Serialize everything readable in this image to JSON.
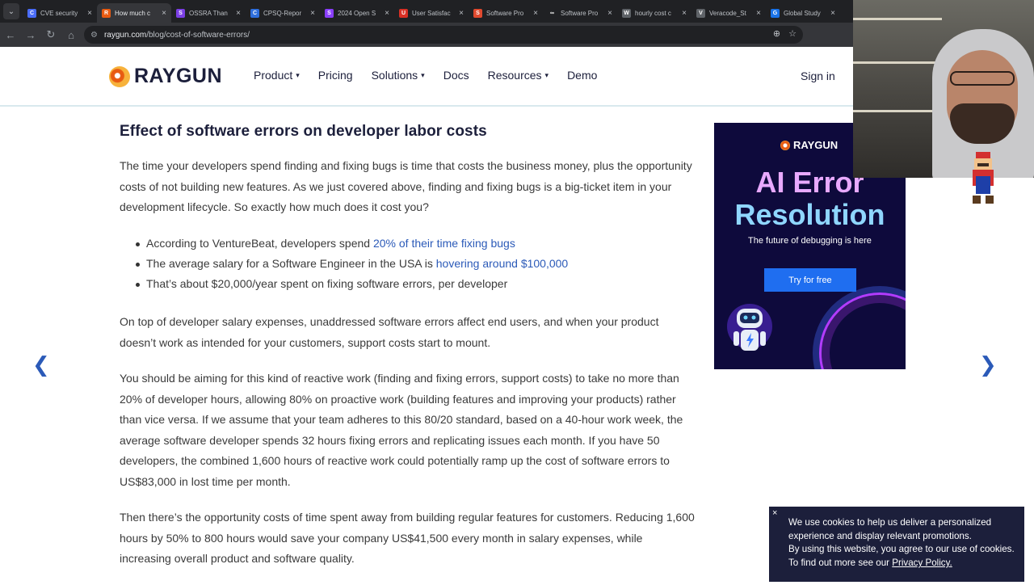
{
  "browser": {
    "tabs": [
      {
        "title": "CVE security",
        "color": "#4a6cf7",
        "glyph": "C"
      },
      {
        "title": "How much c",
        "color": "#e85b12",
        "glyph": "R",
        "active": true
      },
      {
        "title": "OSSRA Than",
        "color": "#7b3fe4",
        "glyph": "S"
      },
      {
        "title": "CPSQ-Repor",
        "color": "#2f6fdd",
        "glyph": "C"
      },
      {
        "title": "2024 Open S",
        "color": "#8a3ffc",
        "glyph": "S"
      },
      {
        "title": "User Satisfac",
        "color": "#d93025",
        "glyph": "U"
      },
      {
        "title": "Software Pro",
        "color": "#e04a2f",
        "glyph": "S"
      },
      {
        "title": "Software Pro",
        "color": "#202124",
        "glyph": "∞"
      },
      {
        "title": "hourly cost c",
        "color": "#5f6368",
        "glyph": "W"
      },
      {
        "title": "Veracode_St",
        "color": "#5f6368",
        "glyph": "V"
      },
      {
        "title": "Global Study",
        "color": "#1a73e8",
        "glyph": "G"
      }
    ],
    "url_domain": "raygun.com",
    "url_path": "/blog/cost-of-software-errors/"
  },
  "header": {
    "logo": "RAYGUN",
    "nav": [
      {
        "label": "Product",
        "dropdown": true
      },
      {
        "label": "Pricing",
        "dropdown": false
      },
      {
        "label": "Solutions",
        "dropdown": true
      },
      {
        "label": "Docs",
        "dropdown": false
      },
      {
        "label": "Resources",
        "dropdown": true
      },
      {
        "label": "Demo",
        "dropdown": false
      }
    ],
    "signin": "Sign in"
  },
  "article": {
    "heading": "Effect of software errors on developer labor costs",
    "p1": "The time your developers spend finding and fixing bugs is time that costs the business money, plus the opportunity costs of not building new features. As we just covered above, finding and fixing bugs is a big-ticket item in your development lifecycle. So exactly how much does it cost you?",
    "bullet1_pre": "According to VentureBeat, developers spend ",
    "bullet1_link": "20% of their time fixing bugs",
    "bullet2_pre": "The average salary for a Software Engineer in the USA is ",
    "bullet2_link": "hovering around $100,000",
    "bullet3": "That’s about $20,000/year spent on fixing software errors, per developer",
    "p2": "On top of developer salary expenses, unaddressed software errors affect end users, and when your product doesn’t work as intended for your customers, support costs start to mount.",
    "p3": "You should be aiming for this kind of reactive work (finding and fixing errors, support costs) to take no more than 20% of developer hours, allowing 80% on proactive work (building features and improving your products) rather than vice versa. If we assume that your team adheres to this 80/20 standard, based on a 40-hour work week, the average software developer spends 32 hours fixing errors and replicating issues each month. If you have 50 developers, the combined 1,600 hours of reactive work could potentially ramp up the cost of software errors to US$83,000 in lost time per month.",
    "p4": "Then there’s the opportunity costs of time spent away from building regular features for customers. Reducing 1,600 hours by 50% to 800 hours would save your company US$41,500 every month in salary expenses, while increasing overall product and software quality."
  },
  "ad": {
    "logo": "RAYGUN",
    "headline1": "AI Error",
    "headline2": "Resolution",
    "subtitle": "The future of debugging is here",
    "cta": "Try for free"
  },
  "cookie": {
    "close": "×",
    "line1": "We use cookies to help us deliver a personalized experience and display relevant promotions.",
    "line2": "By using this website, you agree to our use of cookies.",
    "line3_pre": "To find out more see our ",
    "line3_link": "Privacy Policy."
  }
}
